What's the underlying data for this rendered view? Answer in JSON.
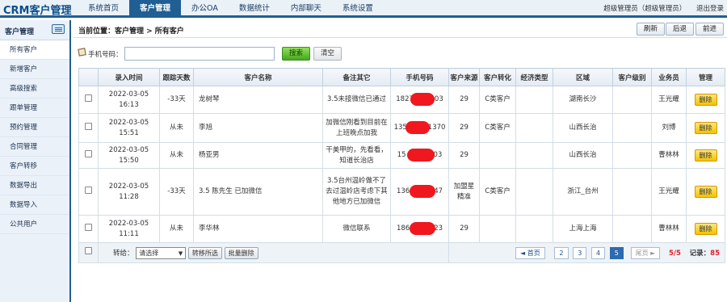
{
  "app": {
    "title": "CRM客户管理"
  },
  "nav": [
    "系统首页",
    "客户管理",
    "办公OA",
    "数据统计",
    "内部聊天",
    "系统设置"
  ],
  "user": {
    "name": "超级管理员（超级管理员）",
    "logout": "退出登录"
  },
  "sidebar": {
    "header": "客户管理",
    "items": [
      "所有客户",
      "新增客户",
      "高级搜索",
      "跟单管理",
      "预约管理",
      "合同管理",
      "客户转移",
      "数据导出",
      "数据导入",
      "公共用户"
    ]
  },
  "breadcrumb": "当前位置：客户管理 > 所有客户",
  "toolbar": {
    "refresh": "刷新",
    "back": "后退",
    "forward": "前进"
  },
  "search": {
    "label": "手机号码：",
    "value": "",
    "placeholder": "",
    "search_button": "搜索",
    "clear_button": "清空"
  },
  "table": {
    "headers": [
      "",
      "录入时间",
      "跟踪天数",
      "客户名称",
      "备注其它",
      "手机号码",
      "客户来源",
      "客户转化",
      "经济类型",
      "区域",
      "客户级别",
      "业务员",
      "管理"
    ],
    "rows": [
      {
        "date": "2022-03-05",
        "time": "16:13",
        "days": "-33天",
        "name": "龙树琴",
        "remark": "3.5未接微信已通过",
        "phone_prefix": "1827",
        "phone_suffix": "03",
        "source": "29",
        "conversion": "C类客户",
        "econ": "",
        "region": "湖南长沙",
        "level": "",
        "staff": "王光耀",
        "action": "删除"
      },
      {
        "date": "2022-03-05",
        "time": "15:51",
        "days": "从未",
        "name": "李旭",
        "remark": "加微信刚看到目前在上班晚点加我",
        "phone_prefix": "135",
        "phone_suffix": "1370",
        "source": "29",
        "conversion": "C类客户",
        "econ": "",
        "region": "山西长治",
        "level": "",
        "staff": "刘博",
        "action": "删除"
      },
      {
        "date": "2022-03-05",
        "time": "15:50",
        "days": "从未",
        "name": "杨亚男",
        "remark": "干美甲的，先看看，知道长治店",
        "phone_prefix": "15",
        "phone_suffix": "03",
        "source": "29",
        "conversion": "",
        "econ": "",
        "region": "山西长治",
        "level": "",
        "staff": "曹林林",
        "action": "删除"
      },
      {
        "date": "2022-03-05",
        "time": "11:28",
        "days": "-33天",
        "name": "3.5 陈先生 已加微信",
        "remark": "3.5台州温岭做不了去过温岭店考虑下其他地方已加微信",
        "phone_prefix": "136",
        "phone_suffix": "47",
        "source": "加盟星精准",
        "conversion": "C类客户",
        "econ": "",
        "region": "浙江_台州",
        "level": "",
        "staff": "王光耀",
        "action": "删除"
      },
      {
        "date": "2022-03-05",
        "time": "11:11",
        "days": "从未",
        "name": "李华林",
        "remark": "微信联系",
        "phone_prefix": "186",
        "phone_suffix": "23",
        "source": "29",
        "conversion": "",
        "econ": "",
        "region": "上海上海",
        "level": "",
        "staff": "曹林林",
        "action": "删除"
      }
    ]
  },
  "footer": {
    "transfer_label": "转给：",
    "select_value": "请选择",
    "transfer_button": "转移所选",
    "batch_delete": "批量删除",
    "first": "◄ 首页",
    "pages": [
      "2",
      "3",
      "4",
      "5"
    ],
    "active_page": "5",
    "last": "尾页 ►",
    "page_stat": "5/5",
    "record_label": "记录：",
    "record_count": "85"
  },
  "colors": {
    "brand": "#1f5f93",
    "search_button": "#46a81d",
    "delete_button": "#f4c200",
    "redaction": "#f0171f"
  }
}
